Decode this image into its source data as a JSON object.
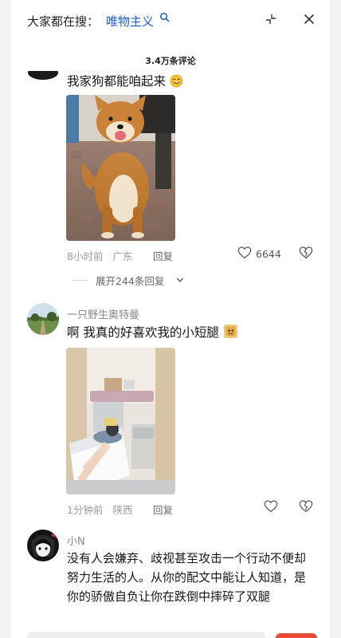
{
  "header": {
    "search_prefix": "大家都在搜：",
    "search_term": "唯物主义",
    "search_icon": "search-icon",
    "collapse_icon": "collapse-icon",
    "close_icon": "close-icon",
    "comment_count": "3.4万条评论"
  },
  "comments": [
    {
      "text": "我家狗都能咱起来",
      "emoji": "smiling-face-icon",
      "photo": "shiba-dog-photo",
      "time": "8小时前",
      "location": "广东",
      "reply_label": "回复",
      "like_count": "6644",
      "expand_label": "展开244条回复"
    },
    {
      "username": "一只野生奥特曼",
      "text": "啊 我真的好喜欢我的小短腿",
      "emoji": "sticker-icon",
      "photo": "hospital-bed-photo",
      "time": "1分钟前",
      "location": "陕西",
      "reply_label": "回复"
    },
    {
      "username": "小N",
      "text": "没有人会嫌弃、歧视甚至攻击一个行动不便却努力生活的人。从你的配文中能让人知道，是你的骄傲自负让你在跌倒中摔碎了双腿"
    }
  ],
  "colors": {
    "accent_blue": "#1d5fd0",
    "muted_text": "#9a9a9a",
    "red": "#e84b3c"
  }
}
